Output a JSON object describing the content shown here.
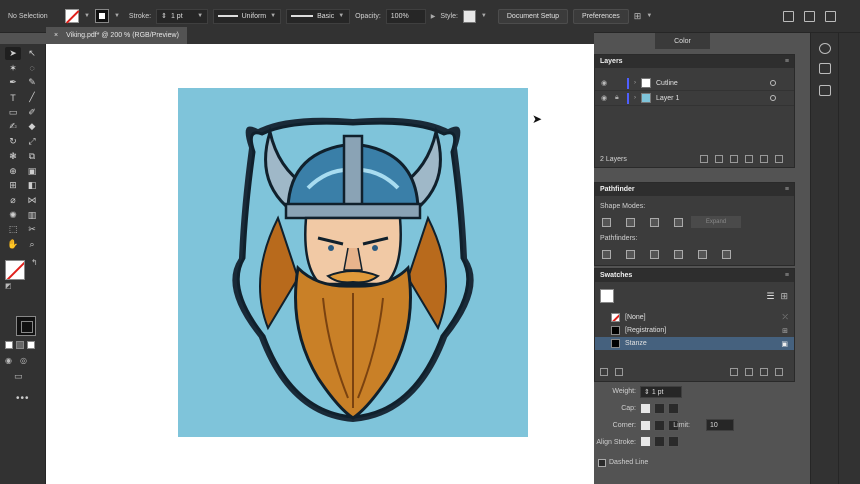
{
  "control_bar": {
    "selection_status": "No Selection",
    "stroke_label": "Stroke:",
    "stroke_weight": "1 pt",
    "profile": "Uniform",
    "brush": "Basic",
    "opacity_label": "Opacity:",
    "opacity_value": "100%",
    "style_label": "Style:",
    "document_setup": "Document Setup",
    "preferences": "Preferences"
  },
  "document": {
    "tab_title": "Viking.pdf* @ 200 % (RGB/Preview)",
    "close_glyph": "×"
  },
  "art": {
    "background_color": "#7fc4da",
    "alt": "Viking head sticker illustration"
  },
  "color_panel_tab": "Color",
  "layers_panel": {
    "title": "Layers",
    "layers": [
      {
        "name": "Cutline"
      },
      {
        "name": "Layer 1"
      }
    ],
    "count": "2 Layers"
  },
  "pathfinder_panel": {
    "title": "Pathfinder",
    "shape_modes": "Shape Modes:",
    "expand": "Expand",
    "pathfinders": "Pathfinders:"
  },
  "swatches_panel": {
    "title": "Swatches",
    "items": [
      {
        "name": "[None]"
      },
      {
        "name": "[Registration]"
      },
      {
        "name": "Stanze"
      }
    ]
  },
  "stroke_panel": {
    "weight_label": "Weight:",
    "weight_value": "1 pt",
    "cap_label": "Cap:",
    "corner_label": "Corner:",
    "limit_label": "Limit:",
    "limit_value": "10",
    "align_label": "Align Stroke:",
    "dashed_label": "Dashed Line"
  },
  "colors": {
    "accent_selection": "#45617e",
    "layer_color": "#4f5fff",
    "none_slash": "#e0201b"
  }
}
